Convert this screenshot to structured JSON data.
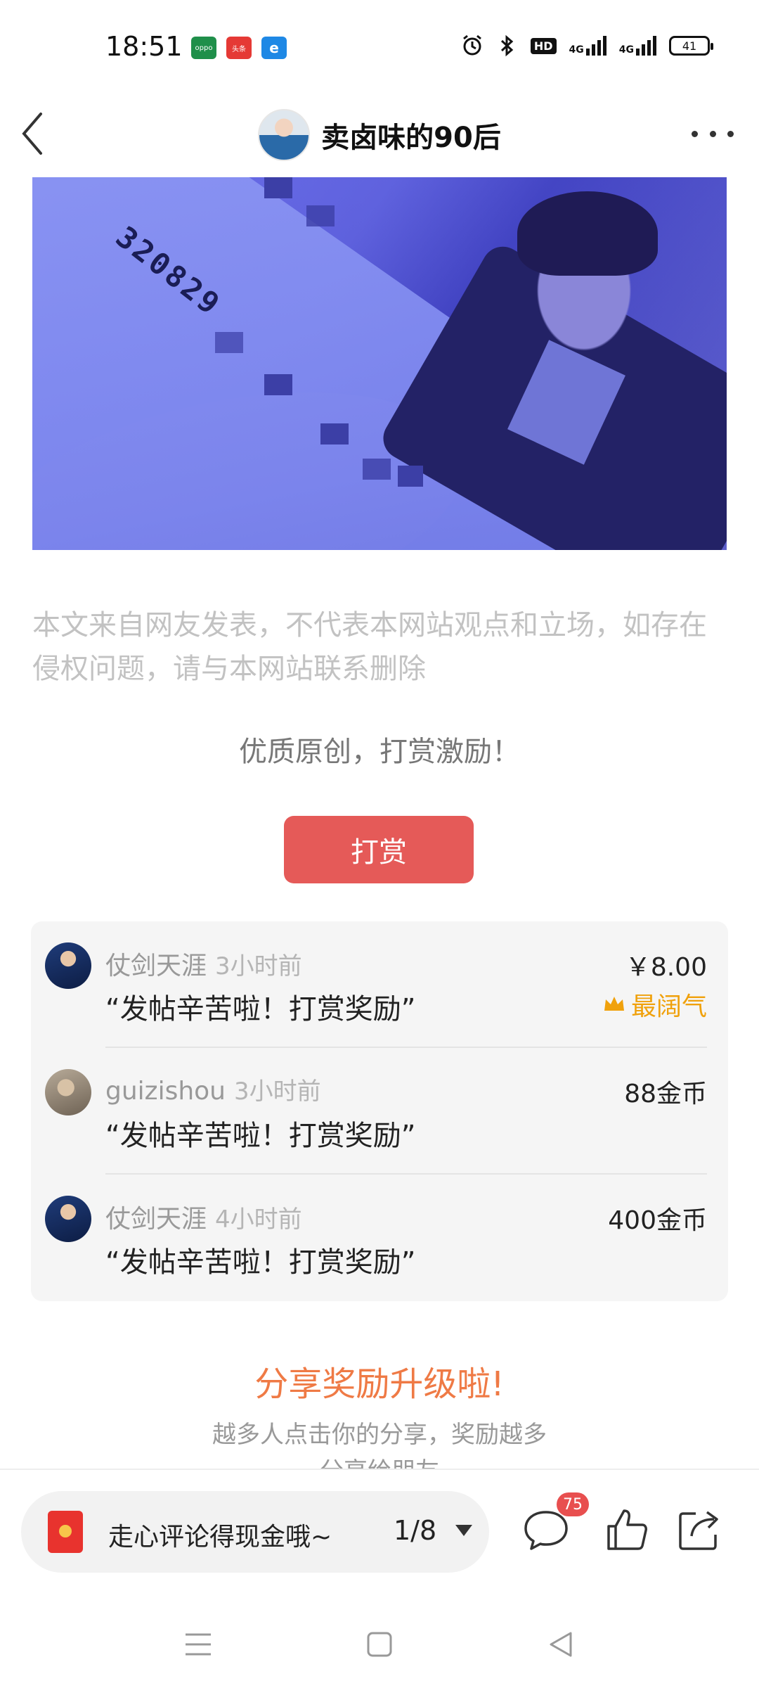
{
  "status_bar": {
    "time": "18:51",
    "apps": [
      "oppo",
      "头条",
      "e"
    ],
    "hd": "HD",
    "signal1": "4G",
    "signal2": "4G",
    "battery": "41"
  },
  "header": {
    "title": "卖卤味的90后"
  },
  "disclaimer": "本文来自网友发表，不代表本网站观点和立场，如存在侵权问题，请与本网站联系删除",
  "image_text": "320829",
  "tip": "优质原创，打赏激励！",
  "reward_button": "打赏",
  "rewards": [
    {
      "name": "仗剑天涯",
      "time": "3小时前",
      "message": "“发帖辛苦啦！打赏奖励”",
      "amount": "￥8.00",
      "badge": "最阔气"
    },
    {
      "name": "guizishou",
      "time": "3小时前",
      "message": "“发帖辛苦啦！打赏奖励”",
      "amount": "88金币"
    },
    {
      "name": "仗剑天涯",
      "time": "4小时前",
      "message": "“发帖辛苦啦！打赏奖励”",
      "amount": "400金币"
    }
  ],
  "share": {
    "title": "分享奖励升级啦!",
    "subtitle": "越多人点击你的分享，奖励越多",
    "subtitle2": "分享给朋友"
  },
  "bottom_bar": {
    "comment_prompt": "走心评论得现金哦~",
    "page": "1/8",
    "comment_count": "75"
  },
  "colors": {
    "accent": "#e55a58",
    "share_title": "#ef7a45",
    "badge_gold": "#f0a10c"
  }
}
